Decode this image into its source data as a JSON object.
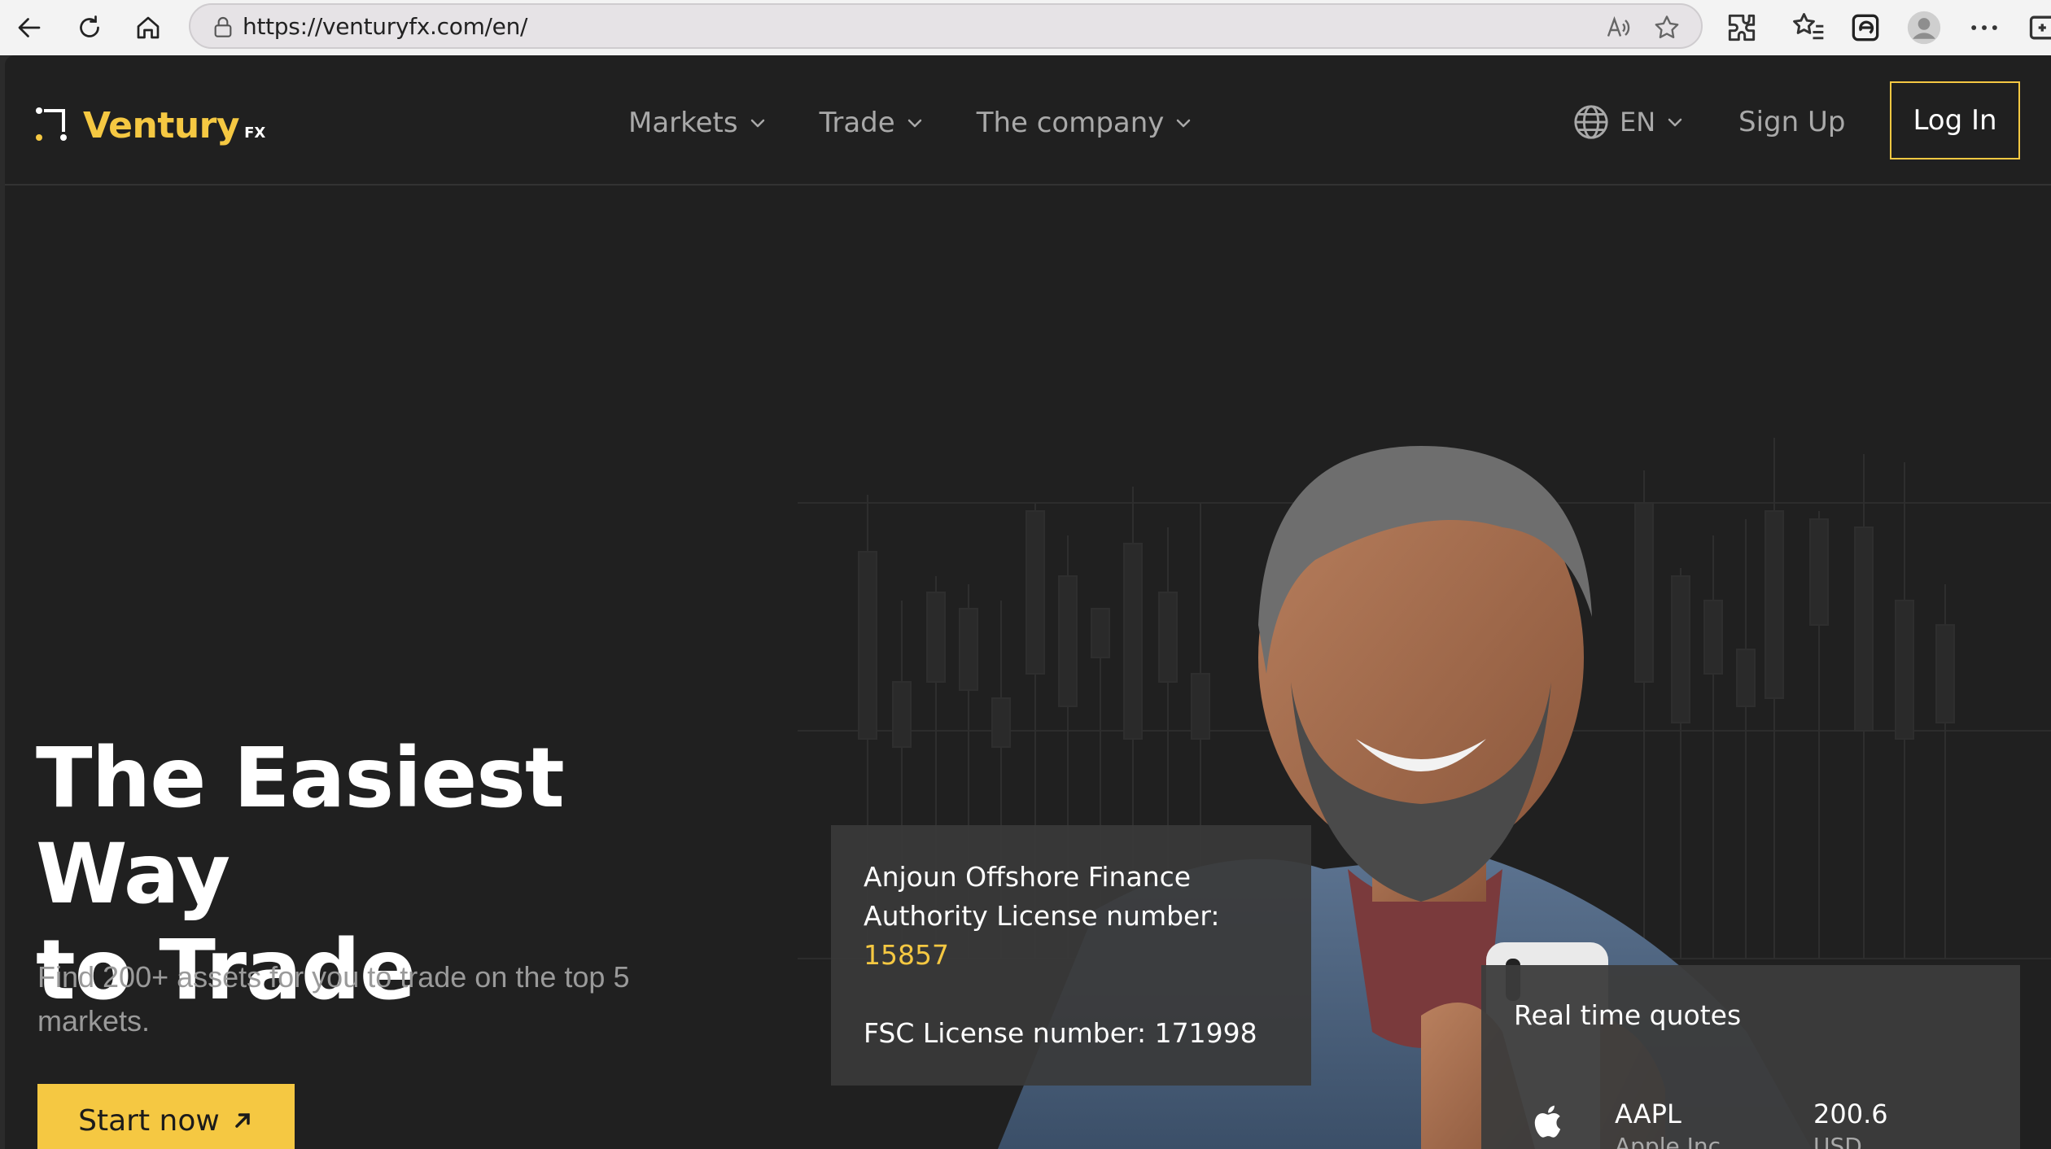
{
  "browser": {
    "url": "https://venturyfx.com/en/"
  },
  "header": {
    "logo_text": "Ventury",
    "logo_suffix": "FX",
    "nav": [
      {
        "label": "Markets"
      },
      {
        "label": "Trade"
      },
      {
        "label": "The company"
      }
    ],
    "language": "EN",
    "signup_label": "Sign Up",
    "login_label": "Log In"
  },
  "hero": {
    "title_line1": "The Easiest Way",
    "title_line2": "to Trade",
    "subtitle": "Find 200+ assets for you to trade on the top 5 markets.",
    "cta_label": "Start now"
  },
  "license": {
    "line1": "Anjoun Offshore Finance",
    "line2": "Authority License number:",
    "number": "15857",
    "fsc": "FSC License number: 171998"
  },
  "quotes": {
    "title": "Real time quotes",
    "items": [
      {
        "symbol": "AAPL",
        "name": "Apple Inc.",
        "price": "200.6",
        "currency": "USD"
      }
    ]
  },
  "colors": {
    "accent": "#f5c842",
    "background": "#202020",
    "nav_text": "#a9a9a9"
  }
}
